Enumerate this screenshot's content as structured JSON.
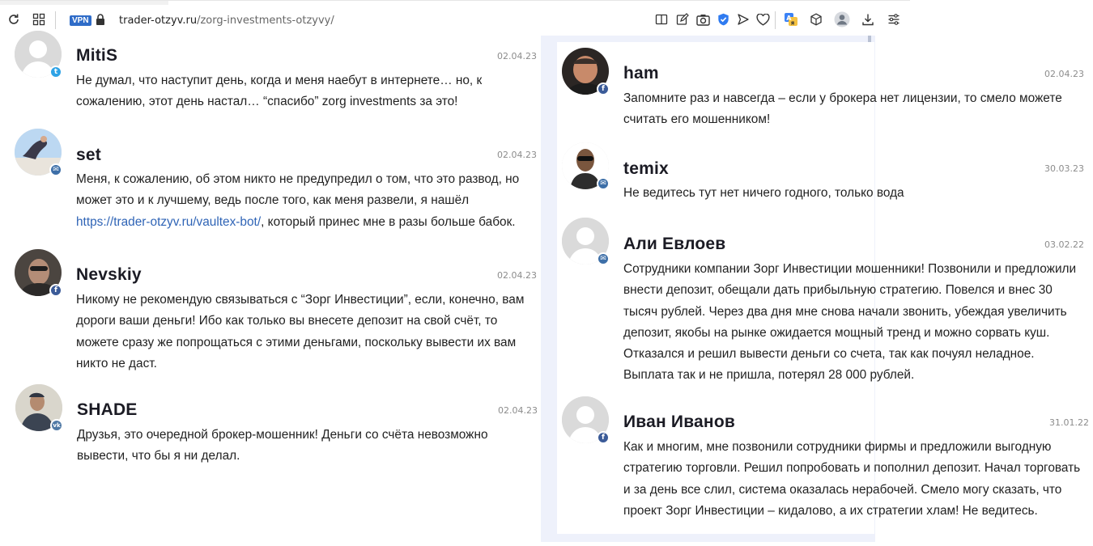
{
  "browser": {
    "vpn_label": "VPN",
    "url_host": "trader-otzyv.ru",
    "url_path": "/zorg-investments-otzyvy/",
    "icons": [
      "reload-icon",
      "grid-icon",
      "lock-icon",
      "reader-icon",
      "edit-icon",
      "camera-icon",
      "shield-icon",
      "send-icon",
      "heart-icon",
      "translate-icon",
      "box-icon",
      "profile-icon",
      "download-icon",
      "settings-icon"
    ]
  },
  "comments_left": [
    {
      "author": "MitiS",
      "date": "02.04.23",
      "social": "twitter",
      "text_lines": [
        "Не думал, что наступит день, когда и меня наебут в интернете… но, к",
        "сожалению, этот день настал… “спасибо” zorg investments за это!"
      ]
    },
    {
      "author": "set",
      "date": "02.04.23",
      "social": "mail",
      "text_lines": [
        "Меня, к сожалению, об этом никто не предупредил о том, что это развод, но",
        "может это и к лучшему, ведь после того, как меня развели, я нашёл"
      ],
      "link": "https://trader-otzyv.ru/vaultex-bot/",
      "link_suffix": ", который принес мне в разы больше бабок."
    },
    {
      "author": "Nevskiy",
      "date": "02.04.23",
      "social": "facebook",
      "text_lines": [
        "Никому не рекомендую связываться с “Зорг Инвестиции”, если, конечно, вам",
        "дороги ваши деньги! Ибо как только вы внесете депозит на свой счёт, то",
        "можете сразу же попрощаться с этими деньгами, поскольку вывести их вам",
        "никто не даст."
      ]
    },
    {
      "author": "SHADE",
      "date": "02.04.23",
      "social": "vk",
      "text_lines": [
        "Друзья, это очередной брокер-мошенник! Деньги со счёта невозможно",
        "вывести, что бы я ни делал."
      ]
    }
  ],
  "comments_right": [
    {
      "author": "ham",
      "date": "02.04.23",
      "social": "facebook",
      "text_lines": [
        "Запомните раз и навсегда – если у брокера нет лицензии, то смело можете",
        "считать его мошенником!"
      ]
    },
    {
      "author": "temix",
      "date": "30.03.23",
      "social": "mail",
      "text_lines": [
        "Не ведитесь тут нет ничего годного, только вода"
      ]
    },
    {
      "author": "Али Евлоев",
      "date": "03.02.22",
      "social": "mail",
      "text_lines": [
        "Сотрудники компании Зорг Инвестиции мошенники! Позвонили и предложили",
        "внести депозит, обещали дать прибыльную стратегию. Повелся и внес 30",
        "тысяч рублей. Через два дня мне снова начали звонить, убеждая увеличить",
        "депозит, якобы на рынке ожидается мощный тренд и можно сорвать куш.",
        "Отказался и решил вывести деньги со счета, так как почуял неладное.",
        "Выплата так и не пришла, потерял 28 000 рублей."
      ]
    },
    {
      "author": "Иван Иванов",
      "date": "31.01.22",
      "social": "facebook",
      "text_lines": [
        "Как и многим, мне позвонили сотрудники фирмы и предложили выгодную",
        "стратегию торговли. Решил попробовать и пополнил депозит. Начал торговать",
        "и за день все слил, система оказалась нерабочей. Смело могу сказать, что",
        "проект Зорг Инвестиции – кидалово, а их стратегии хлам! Не ведитесь."
      ]
    }
  ],
  "social_glyphs": {
    "twitter": "t",
    "mail": "✉",
    "facebook": "f",
    "vk": "vk"
  },
  "colors": {
    "link": "#2f64b6",
    "vpn_badge": "#2f6cc8",
    "right_panel_bg": "#eef1fb",
    "shield": "#2f7bf0"
  }
}
